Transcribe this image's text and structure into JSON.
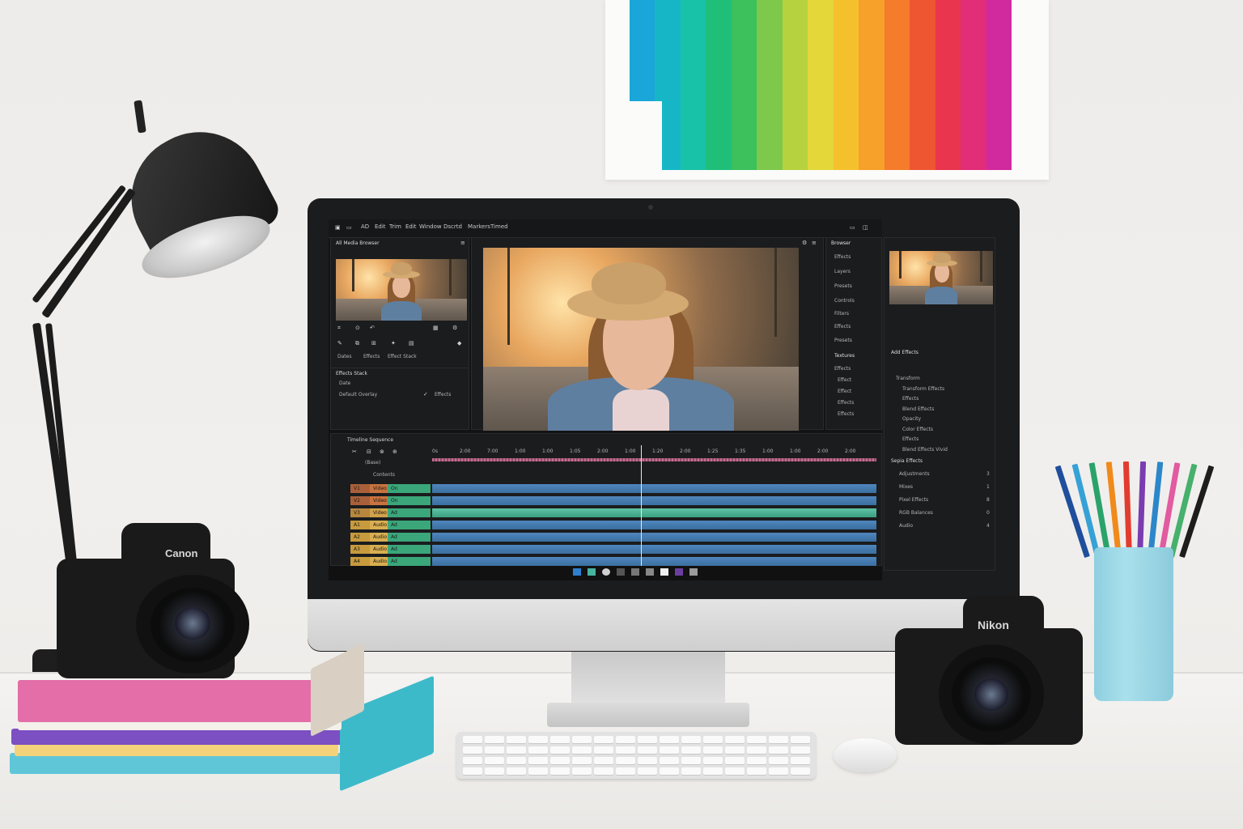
{
  "menubar": {
    "items": [
      "AD",
      "Edit",
      "Trim",
      "Edit",
      "Window",
      "Dscrtd",
      "Markers",
      "Timed"
    ]
  },
  "left_panel": {
    "title": "All Media Browser",
    "effects_title": "Effects Stack",
    "row_labels": [
      "Dates",
      "Effects",
      "Effect Stack",
      "Date",
      "Effects"
    ],
    "item": "Default Overlay"
  },
  "right_panel": {
    "title": "Browser",
    "items": [
      "Effects",
      "Layers",
      "Presets",
      "Controls",
      "Filters",
      "Effects",
      "Presets",
      "Textures",
      "Effects",
      "Effect",
      "Effect",
      "Effects",
      "Effects"
    ],
    "section_title": "Add Effects",
    "list": [
      "Transform",
      "Transform Effects",
      "Effects",
      "Blend Effects",
      "Opacity",
      "Color Effects",
      "Effects",
      "Blend Effects Vivid"
    ],
    "bottom_title": "Sepia Effects",
    "bottom_rows": [
      {
        "label": "Adjustments",
        "value": "3"
      },
      {
        "label": "Mixes",
        "value": "1"
      },
      {
        "label": "Pixel Effects",
        "value": "8"
      },
      {
        "label": "RGB Balances",
        "value": "0"
      },
      {
        "label": "Audio",
        "value": "4"
      }
    ]
  },
  "timeline": {
    "header": "Timeline Sequence",
    "sub_label": "(Base)",
    "track_header": "Contents",
    "ticks": [
      "0s",
      "2:00",
      "7:00",
      "1:00",
      "1:00",
      "1:05",
      "2:00",
      "1:00",
      "1:20",
      "2:00",
      "1:25",
      "1:35",
      "1:00",
      "1:00",
      "2:00",
      "2:00"
    ],
    "rows": [
      {
        "a": "V1",
        "b": "Video",
        "c": "On"
      },
      {
        "a": "V2",
        "b": "Video",
        "c": "On"
      },
      {
        "a": "V3",
        "b": "Video",
        "c": "Ad"
      },
      {
        "a": "A1",
        "b": "Audio",
        "c": "Ad"
      },
      {
        "a": "A2",
        "b": "Audio",
        "c": "Ad"
      },
      {
        "a": "A3",
        "b": "Audio",
        "c": "Ad"
      },
      {
        "a": "A4",
        "b": "Audio",
        "c": "Ad"
      }
    ]
  },
  "objects": {
    "left_camera_brand": "Canon",
    "right_camera_brand": "Nikon"
  },
  "colors": {
    "rainbow": [
      "#1aa6d8",
      "#17b6c7",
      "#18c2a9",
      "#1fbf7a",
      "#3cc15c",
      "#7ec84b",
      "#b6d23f",
      "#e3d73a",
      "#f4c12d",
      "#f7a02a",
      "#f47c2b",
      "#ee5632",
      "#e9354d",
      "#e22d79",
      "#d1299e"
    ],
    "pencils": [
      "#1f4e9c",
      "#36a1d6",
      "#2aa36b",
      "#f08a1a",
      "#e23c2f",
      "#7a3cb0",
      "#2b87c9",
      "#e25aa0",
      "#46b06c",
      "#1d1d1d"
    ]
  }
}
